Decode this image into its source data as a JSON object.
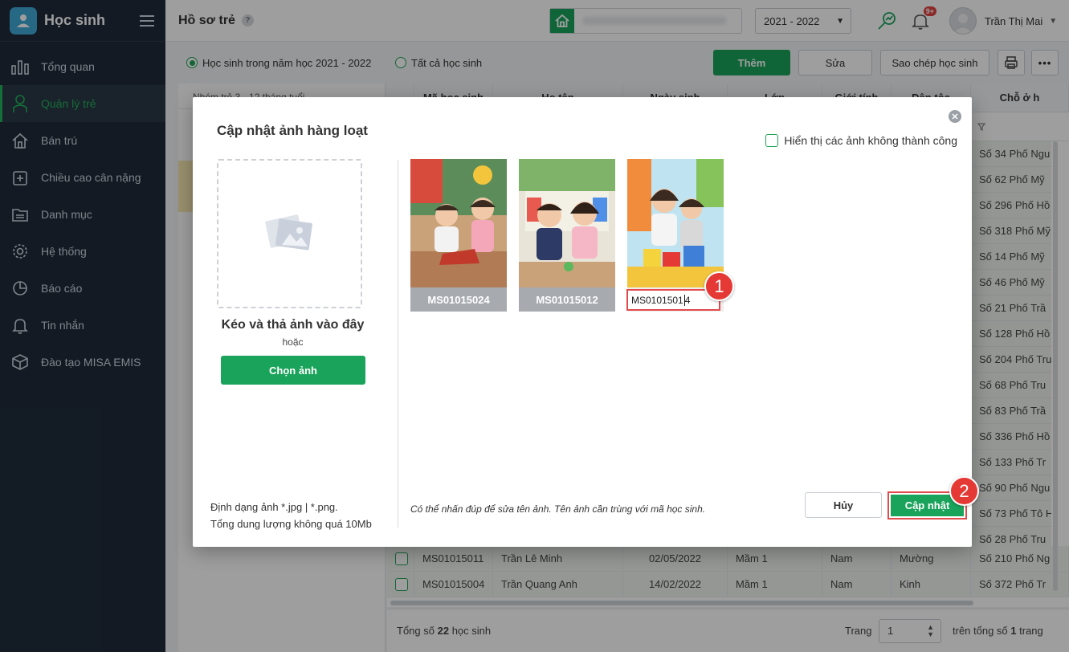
{
  "app": {
    "title": "Học sinh"
  },
  "sidebar": {
    "items": [
      {
        "label": "Tổng quan",
        "icon": "chart-bar-icon"
      },
      {
        "label": "Quản lý trẻ",
        "icon": "child-icon",
        "active": true
      },
      {
        "label": "Bán trú",
        "icon": "home-icon"
      },
      {
        "label": "Chiều cao cân nặng",
        "icon": "health-plus-icon"
      },
      {
        "label": "Danh mục",
        "icon": "folder-icon"
      },
      {
        "label": "Hệ thống",
        "icon": "gear-icon"
      },
      {
        "label": "Báo cáo",
        "icon": "pie-chart-icon"
      },
      {
        "label": "Tin nhắn",
        "icon": "bell-icon"
      },
      {
        "label": "Đào tạo MISA EMIS",
        "icon": "cube-icon"
      }
    ]
  },
  "header": {
    "page_title": "Hồ sơ trẻ",
    "help": "?",
    "school_year": "2021 - 2022",
    "notification_badge": "9+",
    "user_name": "Trần Thị Mai"
  },
  "filters": {
    "radio_current_year": "Học sinh trong năm học 2021 - 2022",
    "radio_all": "Tất cả học sinh",
    "add_label": "Thêm",
    "edit_label": "Sửa",
    "copy_label": "Sao chép học sinh"
  },
  "groups": {
    "title": "Nhóm trẻ 3 - 12 tháng tuổi"
  },
  "table": {
    "columns": [
      "Mã học sinh",
      "Họ tên",
      "Ngày sinh",
      "Lớp",
      "Giới tính",
      "Dân tộc",
      "Chỗ ở h"
    ],
    "side_addresses": [
      "Số 34 Phố Ngu",
      "Số 62 Phố Mỹ",
      "Số 296 Phố Hồ",
      "Số 318 Phố Mỹ",
      "Số 14 Phố Mỹ",
      "Số 46 Phố Mỹ",
      "Số 21 Phố Trầ",
      "Số 128 Phố Hồ",
      "Số 204 Phố Tru",
      "Số 68 Phố Tru",
      "Số 83 Phố Trầ",
      "Số 336 Phố Hồ",
      "Số 133 Phố Tr",
      "Số 90 Phố Ngu",
      "Số 73 Phố Tô H",
      "Số 28 Phố Tru"
    ],
    "rows": [
      {
        "code": "MS01015011",
        "name": "Trần Lê Minh",
        "dob": "02/05/2022",
        "class": "Mầm 1",
        "gender": "Nam",
        "ethnic": "Mường",
        "address": "Số 210 Phố Ng"
      },
      {
        "code": "MS01015004",
        "name": "Trần Quang Anh",
        "dob": "14/02/2022",
        "class": "Mầm 1",
        "gender": "Nam",
        "ethnic": "Kinh",
        "address": "Số 372 Phố Tr"
      }
    ]
  },
  "footer": {
    "total_prefix": "Tổng số",
    "total_count": "22",
    "total_suffix": "học sinh",
    "page_label": "Trang",
    "page_value": "1",
    "of_prefix": "trên tổng số",
    "of_count": "1",
    "of_suffix": "trang"
  },
  "modal": {
    "title": "Cập nhật ảnh hàng loạt",
    "show_failed_label": "Hiển thị các ảnh không thành công",
    "drop_title": "Kéo và thả ảnh vào đây",
    "drop_or": "hoặc",
    "choose_label": "Chọn ảnh",
    "format_line1": "Định dạng ảnh *.jpg | *.png.",
    "format_line2": "Tổng dung lượng không quá 10Mb",
    "hint": "Có thể nhấn đúp để sửa tên ảnh. Tên ảnh cần trùng với mã học sinh.",
    "cancel_label": "Hủy",
    "update_label": "Cập nhật",
    "photos": [
      {
        "caption": "MS01015024"
      },
      {
        "caption": "MS01015012"
      },
      {
        "caption": "MS01015014"
      }
    ],
    "edit_value_before": "MS0101501",
    "edit_value_after": "4",
    "step1": "1",
    "step2": "2"
  },
  "colors": {
    "brand_green": "#1aa35b",
    "sidebar_bg": "#1f2b3a",
    "highlight_red": "#e24b4b"
  }
}
